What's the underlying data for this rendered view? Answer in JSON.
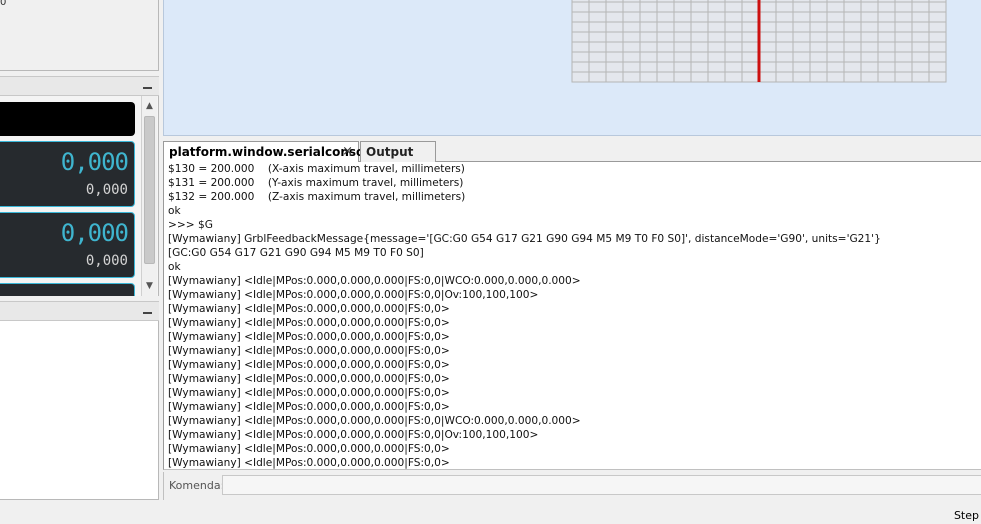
{
  "left_top": {
    "stub_text": "0"
  },
  "dro": {
    "x": {
      "main": "0,000",
      "sub": "0,000"
    },
    "y": {
      "main": "0,000",
      "sub": "0,000"
    }
  },
  "icons": {
    "minimize": "minimize-icon",
    "scroll_up": "chevron-up-icon",
    "scroll_down": "chevron-down-icon",
    "tab_close": "close-icon"
  },
  "colors": {
    "visualizer_bg": "#dce9f9",
    "grid_line": "#b5b5b5",
    "grid_fill": "#e4e7ed",
    "axis_line": "#cc1111",
    "dro_accent": "#3fb5cf",
    "dro_border": "#3ab7d8"
  },
  "tabs": [
    {
      "label": "platform.window.serialconsole",
      "close": "×"
    },
    {
      "label": "Output"
    }
  ],
  "console_lines": [
    "$130 = 200.000    (X-axis maximum travel, millimeters)",
    "$131 = 200.000    (Y-axis maximum travel, millimeters)",
    "$132 = 200.000    (Z-axis maximum travel, millimeters)",
    "ok",
    ">>> $G",
    "[Wymawiany] GrblFeedbackMessage{message='[GC:G0 G54 G17 G21 G90 G94 M5 M9 T0 F0 S0]', distanceMode='G90', units='G21'}",
    "[GC:G0 G54 G17 G21 G90 G94 M5 M9 T0 F0 S0]",
    "ok",
    "[Wymawiany] <Idle|MPos:0.000,0.000,0.000|FS:0,0|WCO:0.000,0.000,0.000>",
    "[Wymawiany] <Idle|MPos:0.000,0.000,0.000|FS:0,0|Ov:100,100,100>",
    "[Wymawiany] <Idle|MPos:0.000,0.000,0.000|FS:0,0>",
    "[Wymawiany] <Idle|MPos:0.000,0.000,0.000|FS:0,0>",
    "[Wymawiany] <Idle|MPos:0.000,0.000,0.000|FS:0,0>",
    "[Wymawiany] <Idle|MPos:0.000,0.000,0.000|FS:0,0>",
    "[Wymawiany] <Idle|MPos:0.000,0.000,0.000|FS:0,0>",
    "[Wymawiany] <Idle|MPos:0.000,0.000,0.000|FS:0,0>",
    "[Wymawiany] <Idle|MPos:0.000,0.000,0.000|FS:0,0>",
    "[Wymawiany] <Idle|MPos:0.000,0.000,0.000|FS:0,0>",
    "[Wymawiany] <Idle|MPos:0.000,0.000,0.000|FS:0,0|WCO:0.000,0.000,0.000>",
    "[Wymawiany] <Idle|MPos:0.000,0.000,0.000|FS:0,0|Ov:100,100,100>",
    "[Wymawiany] <Idle|MPos:0.000,0.000,0.000|FS:0,0>",
    "[Wymawiany] <Idle|MPos:0.000,0.000,0.000|FS:0,0>"
  ],
  "command": {
    "label": "Komenda:",
    "value": ""
  },
  "statusbar": {
    "step": "Step"
  }
}
